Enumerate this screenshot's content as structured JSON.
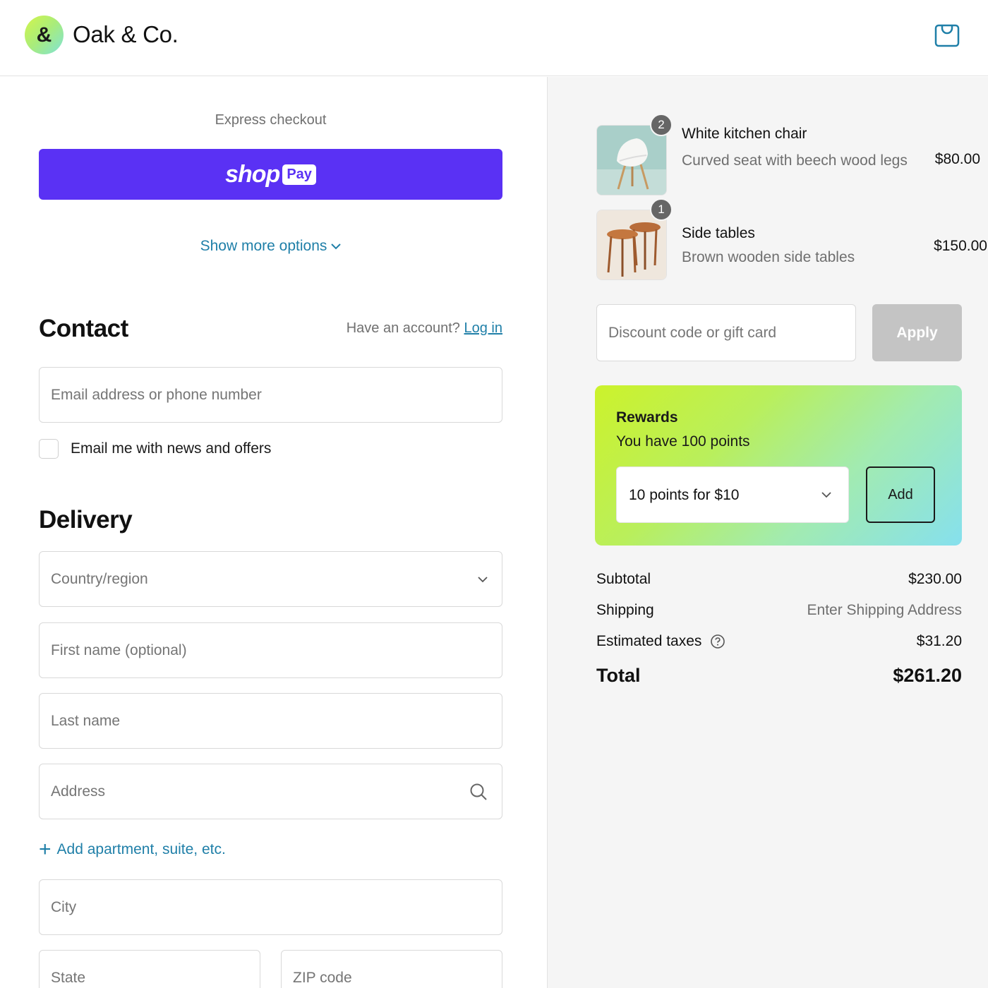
{
  "header": {
    "logo_glyph": "&",
    "brand": "Oak & Co.",
    "cart_icon": "shopping-bag-icon"
  },
  "express": {
    "label": "Express checkout",
    "shoppay_word": "shop",
    "shoppay_pill": "Pay",
    "more_options": "Show more options"
  },
  "contact": {
    "title": "Contact",
    "account_prompt": "Have an account?",
    "login_label": "Log in",
    "email_placeholder": "Email address or phone number",
    "newsletter_label": "Email me with news and offers"
  },
  "delivery": {
    "title": "Delivery",
    "country_placeholder": "Country/region",
    "first_name_placeholder": "First name (optional)",
    "last_name_placeholder": "Last name",
    "address_placeholder": "Address",
    "add_apartment_label": "Add apartment, suite, etc.",
    "city_placeholder": "City",
    "state_placeholder": "State",
    "zip_placeholder": "ZIP code"
  },
  "cart": {
    "items": [
      {
        "qty": "2",
        "name": "White kitchen chair",
        "desc": "Curved seat with beech wood legs",
        "price": "$80.00"
      },
      {
        "qty": "1",
        "name": "Side tables",
        "desc": "Brown wooden side tables",
        "price": "$150.00"
      }
    ]
  },
  "discount": {
    "placeholder": "Discount code or gift card",
    "apply_label": "Apply"
  },
  "rewards": {
    "title": "Rewards",
    "subtitle": "You have 100 points",
    "selected_option": "10 points for $10",
    "add_label": "Add"
  },
  "summary": {
    "subtotal_label": "Subtotal",
    "subtotal_value": "$230.00",
    "shipping_label": "Shipping",
    "shipping_value": "Enter Shipping Address",
    "taxes_label": "Estimated taxes",
    "taxes_value": "$31.20",
    "total_label": "Total",
    "total_value": "$261.20"
  },
  "colors": {
    "shoppay": "#5a31f4",
    "link": "#1f7fa8",
    "apply_disabled": "#c4c4c4"
  }
}
